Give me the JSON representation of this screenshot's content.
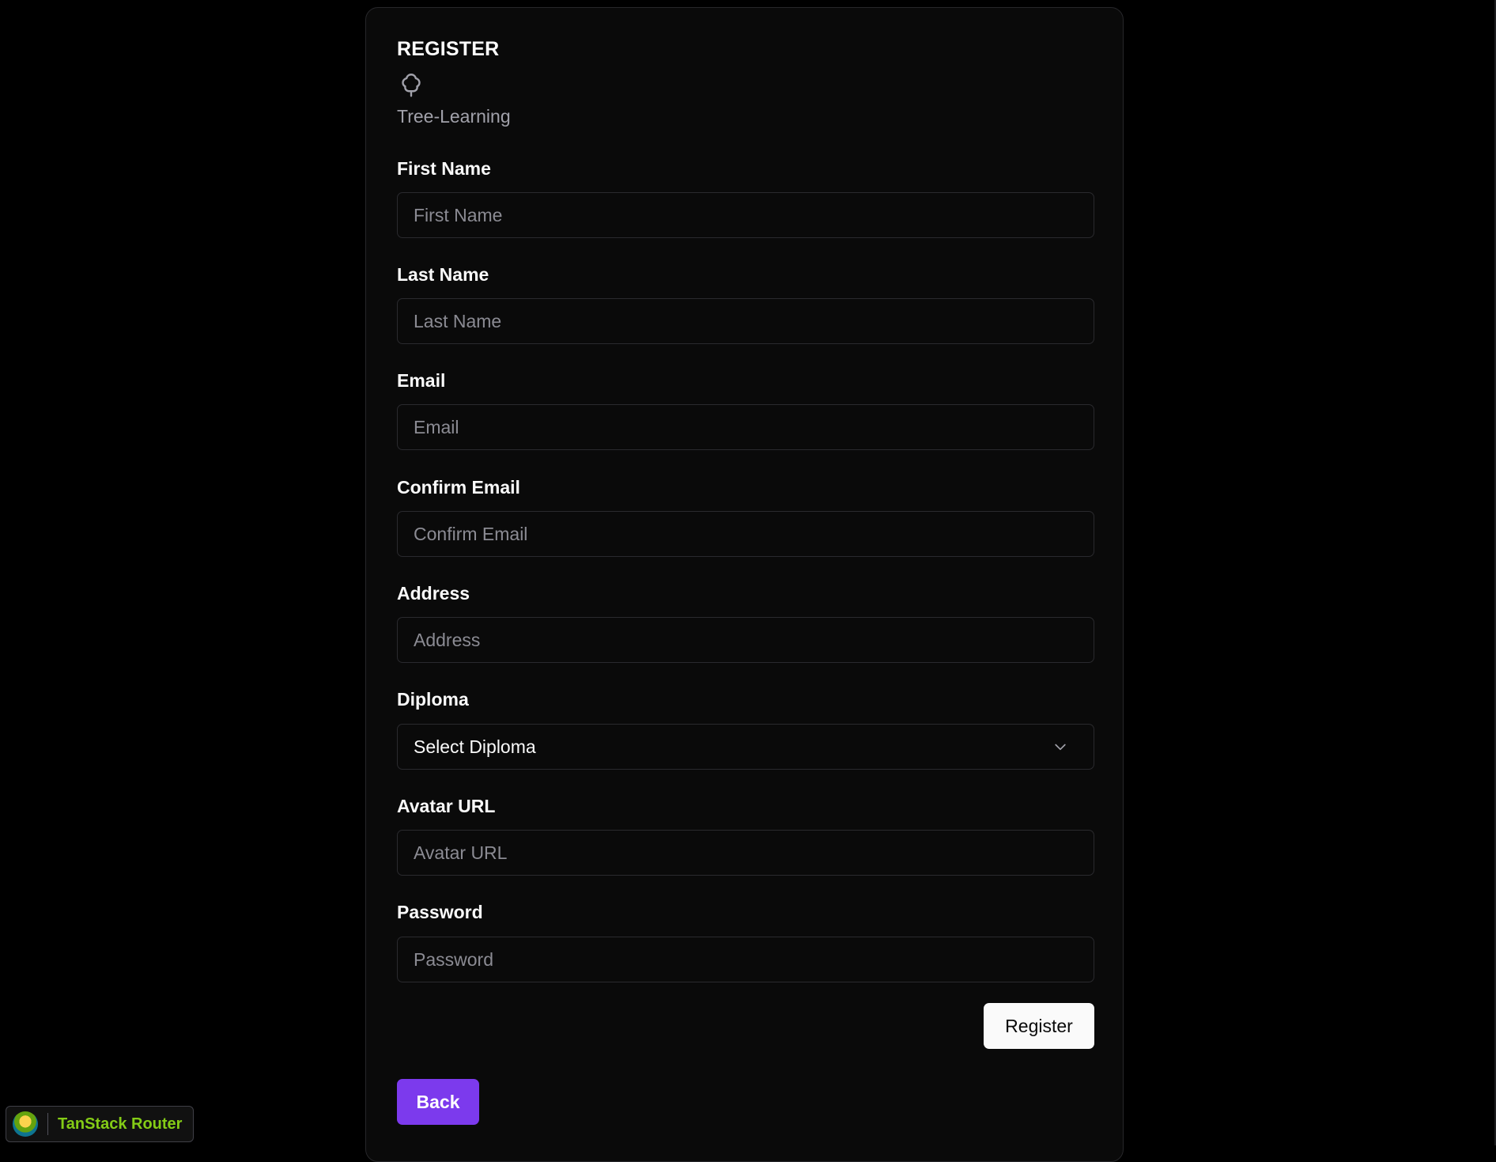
{
  "form": {
    "title": "REGISTER",
    "brand": "Tree-Learning",
    "brand_icon": "tree-icon",
    "fields": [
      {
        "label": "First Name",
        "placeholder": "First Name",
        "value": ""
      },
      {
        "label": "Last Name",
        "placeholder": "Last Name",
        "value": ""
      },
      {
        "label": "Email",
        "placeholder": "Email",
        "value": ""
      },
      {
        "label": "Confirm Email",
        "placeholder": "Confirm Email",
        "value": ""
      },
      {
        "label": "Address",
        "placeholder": "Address",
        "value": ""
      },
      {
        "label": "Diploma",
        "selected": "Select Diploma",
        "icon": "chevron-down-icon"
      },
      {
        "label": "Avatar URL",
        "placeholder": "Avatar URL",
        "value": ""
      },
      {
        "label": "Password",
        "placeholder": "Password",
        "value": ""
      }
    ],
    "register_label": "Register",
    "back_label": "Back"
  },
  "devtools": {
    "label": "TanStack Router",
    "logo_icon": "tanstack-logo-icon"
  },
  "colors": {
    "background": "#000000",
    "card": "#0a0a0a",
    "accent": "#7c3aed",
    "devtools_label": "#84cc16"
  }
}
